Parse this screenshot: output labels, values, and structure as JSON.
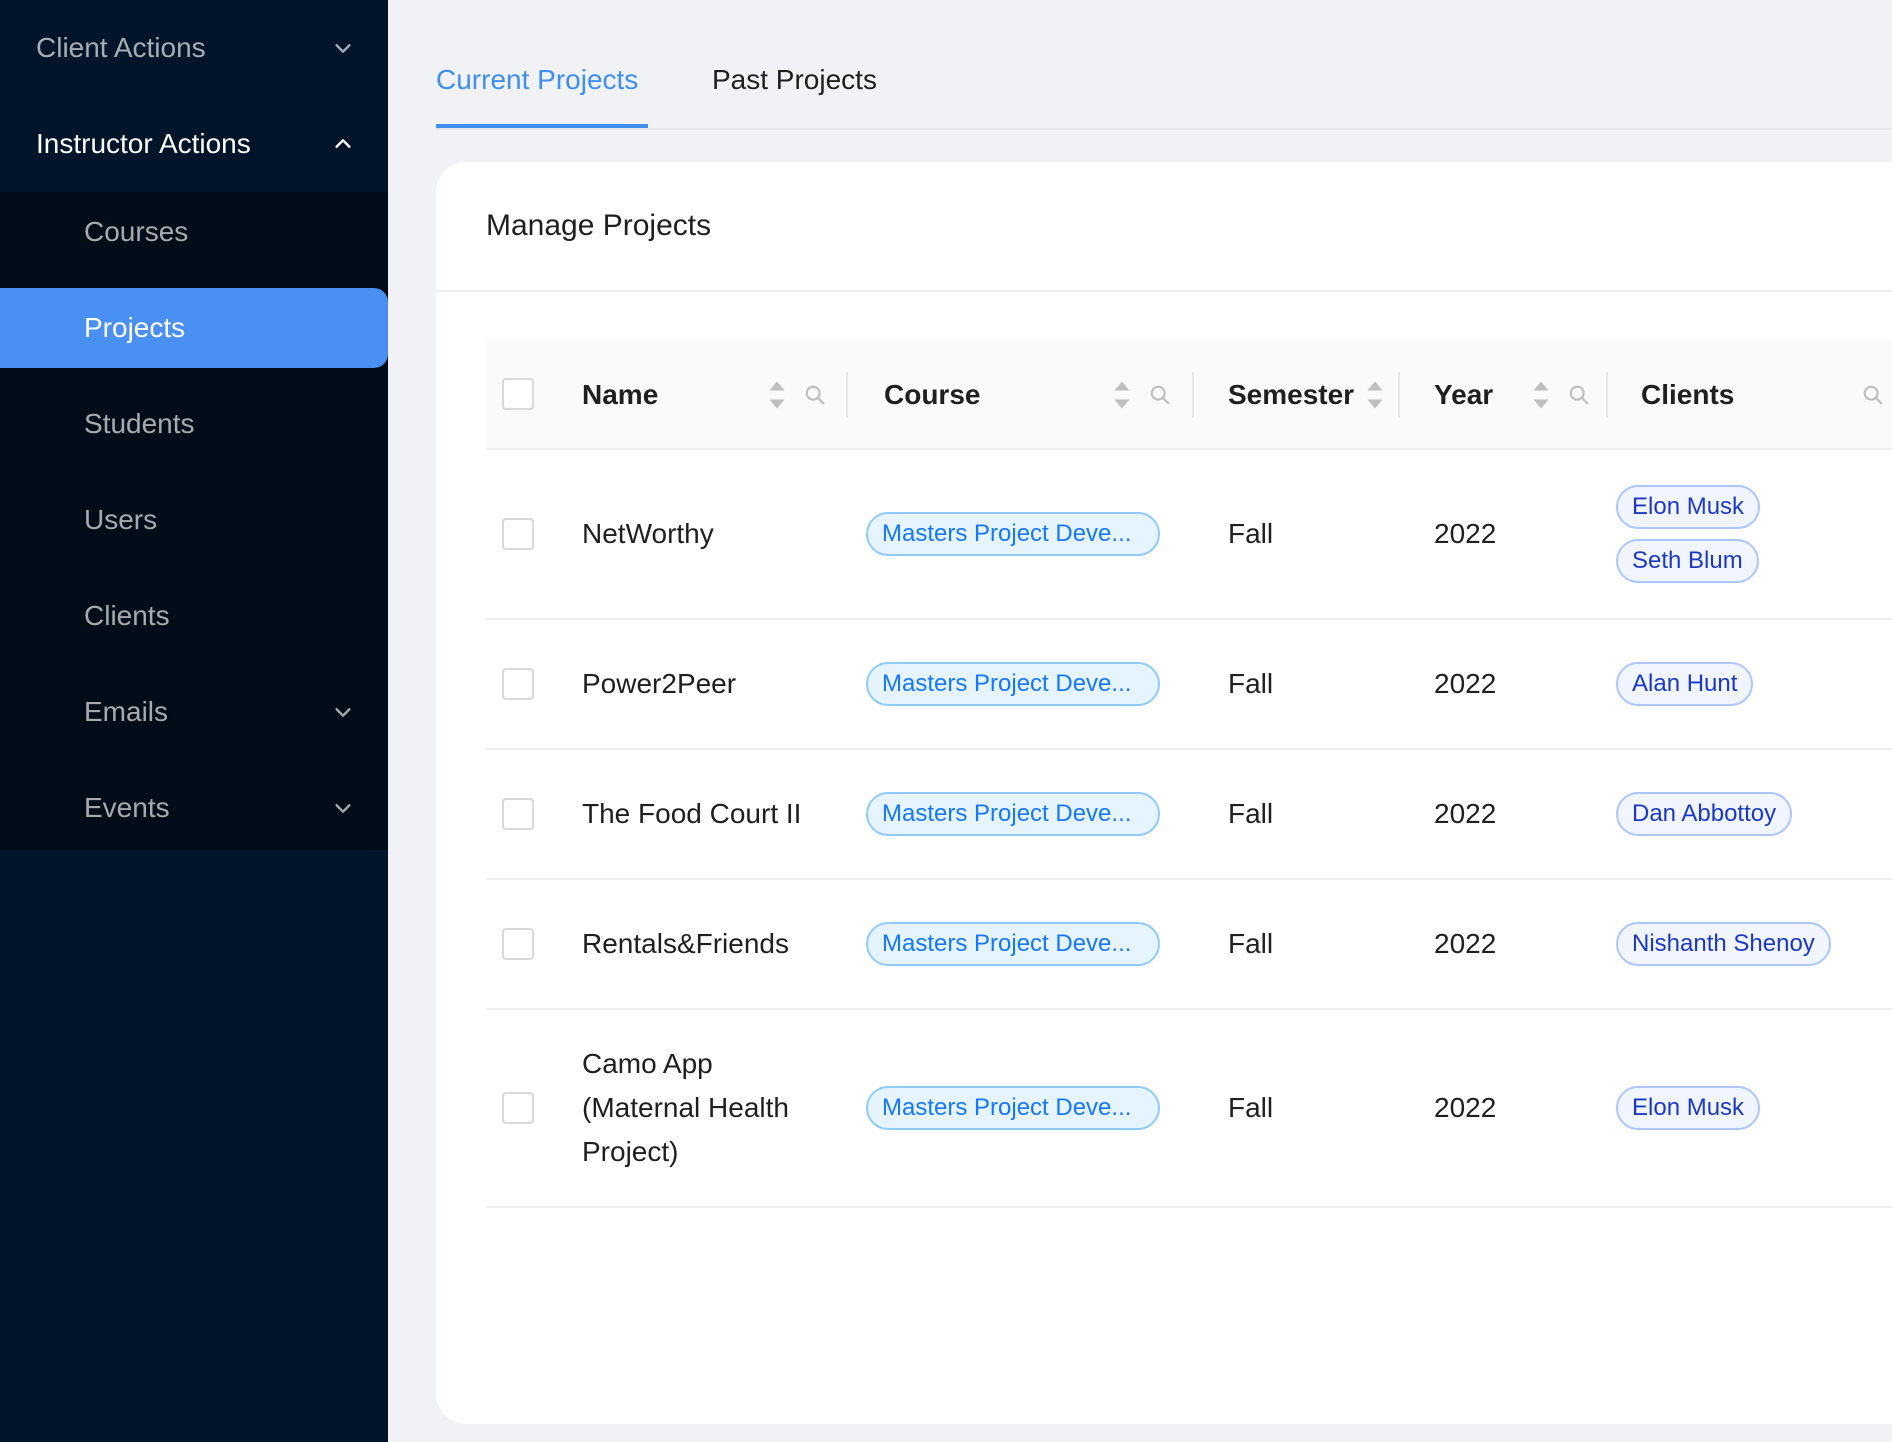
{
  "sidebar": {
    "client_actions": "Client Actions",
    "instructor_actions": "Instructor Actions",
    "items": [
      {
        "label": "Courses"
      },
      {
        "label": "Projects"
      },
      {
        "label": "Students"
      },
      {
        "label": "Users"
      },
      {
        "label": "Clients"
      },
      {
        "label": "Emails"
      },
      {
        "label": "Events"
      }
    ],
    "active_item": "Projects"
  },
  "tabs": [
    {
      "label": "Current Projects",
      "active": true
    },
    {
      "label": "Past Projects",
      "active": false
    }
  ],
  "card": {
    "title": "Manage Projects"
  },
  "table": {
    "columns": [
      "Name",
      "Course",
      "Semester",
      "Year",
      "Clients"
    ],
    "rows": [
      {
        "name": "NetWorthy",
        "course": "Masters Project Deve...",
        "semester": "Fall",
        "year": "2022",
        "clients": [
          "Elon Musk",
          "Seth Blum"
        ]
      },
      {
        "name": "Power2Peer",
        "course": "Masters Project Deve...",
        "semester": "Fall",
        "year": "2022",
        "clients": [
          "Alan Hunt"
        ]
      },
      {
        "name": "The Food Court II",
        "course": "Masters Project Deve...",
        "semester": "Fall",
        "year": "2022",
        "clients": [
          "Dan Abbottoy"
        ]
      },
      {
        "name": "Rentals&Friends",
        "course": "Masters Project Deve...",
        "semester": "Fall",
        "year": "2022",
        "clients": [
          "Nishanth Shenoy"
        ]
      },
      {
        "name": "Camo App (Maternal Health Project)",
        "course": "Masters Project Deve...",
        "semester": "Fall",
        "year": "2022",
        "clients": [
          "Elon Musk"
        ]
      }
    ]
  },
  "colors": {
    "sidebar_bg": "#001529",
    "submenu_bg": "#000c17",
    "accent": "#4a90f2",
    "tab_active": "#3f8ef0"
  }
}
